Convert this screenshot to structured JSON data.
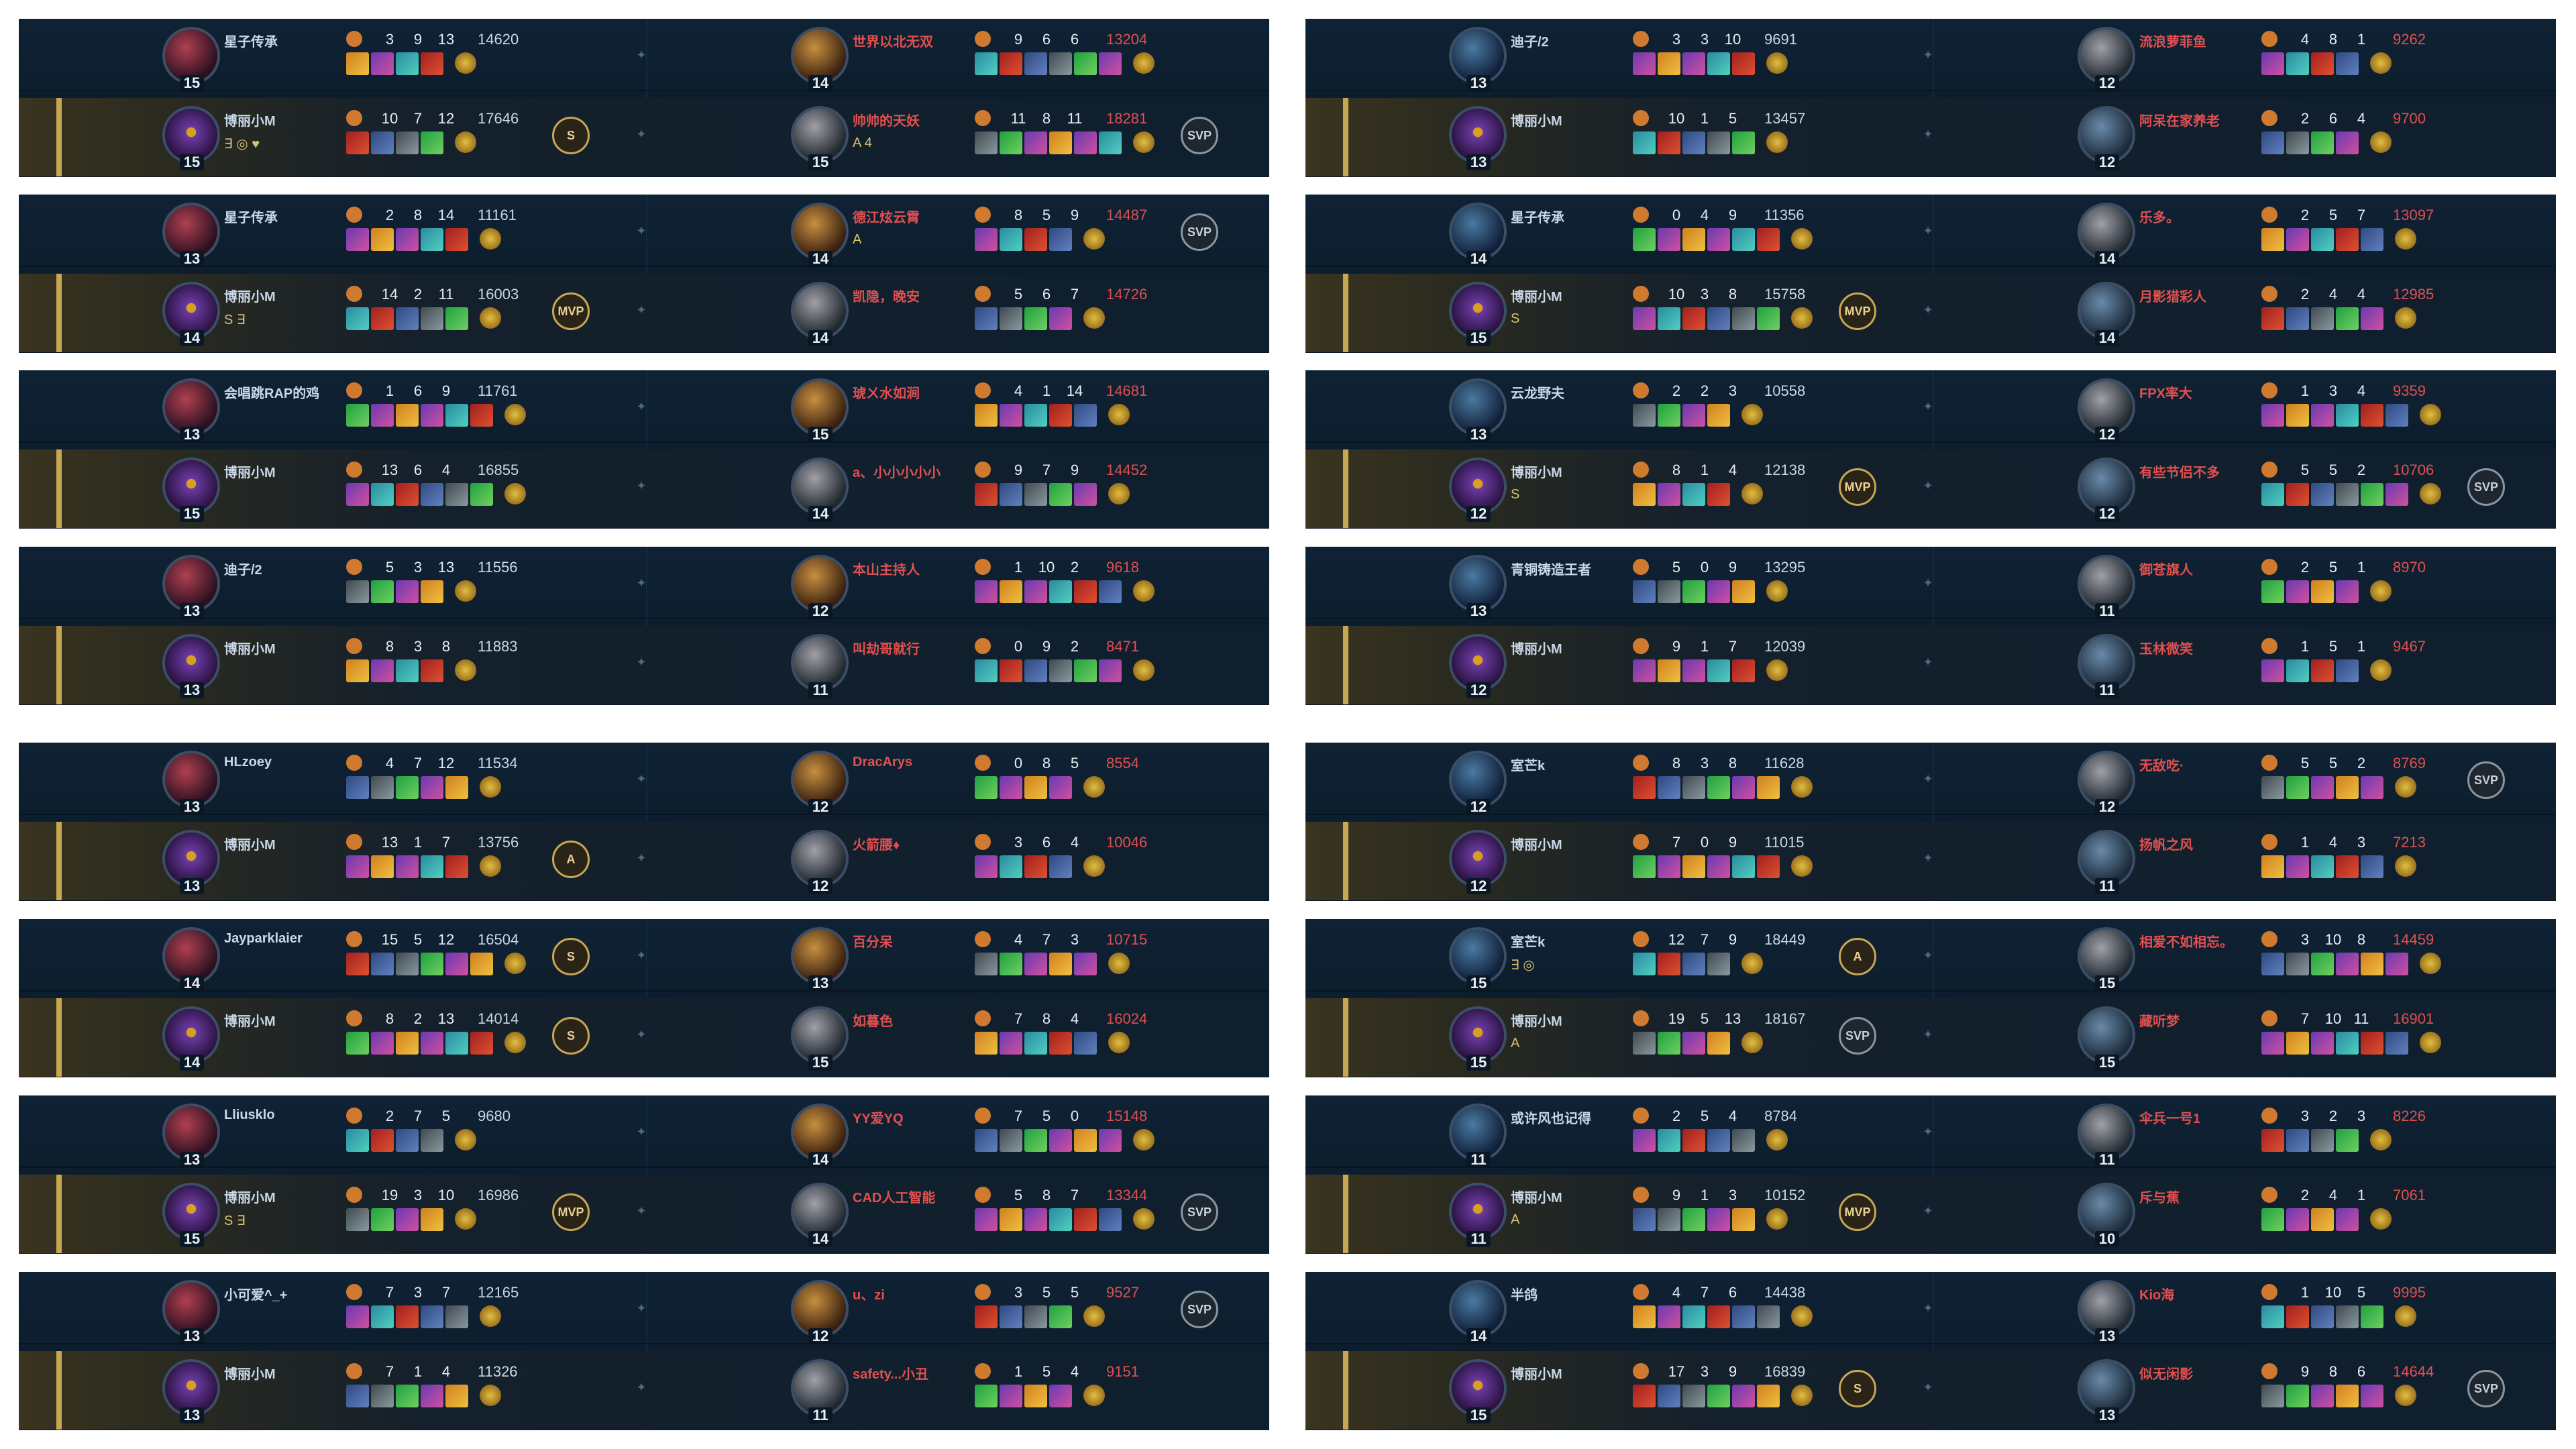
{
  "icons": {
    "kda_rank": "role-icon",
    "item": "item-icon",
    "trinket": "trinket-icon",
    "mvp": "mvp-badge",
    "sword": "sword-icon"
  },
  "colors": {
    "background": "#0b1a2a",
    "gold_ally": "#c8d8e8",
    "gold_enemy": "#e05050",
    "highlight": "#c8a753"
  },
  "columns": [
    {
      "cards": [
        {
          "rows": [
            {
              "L": {
                "name": "星子传承",
                "level": "15",
                "k": "3",
                "d": "9",
                "a": "13",
                "gold": "14620",
                "tags": ""
              },
              "R": {
                "name": "世界以北无双",
                "level": "14",
                "k": "9",
                "d": "6",
                "a": "6",
                "gold": "13204",
                "tags": ""
              },
              "badgeL": "",
              "badgeR": ""
            },
            {
              "L": {
                "name": "博丽小M",
                "level": "15",
                "k": "10",
                "d": "7",
                "a": "12",
                "gold": "17646",
                "tags": "∃ ◎ ♥"
              },
              "R": {
                "name": "帅帅的天妖",
                "level": "15",
                "k": "11",
                "d": "8",
                "a": "11",
                "gold": "18281",
                "tags": "A 4"
              },
              "badgeL": "S",
              "badgeR": "SVP"
            }
          ]
        },
        {
          "rows": [
            {
              "L": {
                "name": "星子传承",
                "level": "13",
                "k": "2",
                "d": "8",
                "a": "14",
                "gold": "11161",
                "tags": ""
              },
              "R": {
                "name": "德江炫云霄",
                "level": "14",
                "k": "8",
                "d": "5",
                "a": "9",
                "gold": "14487",
                "tags": "A"
              },
              "badgeL": "",
              "badgeR": "SVP"
            },
            {
              "L": {
                "name": "博丽小M",
                "level": "14",
                "k": "14",
                "d": "2",
                "a": "11",
                "gold": "16003",
                "tags": "S ∃"
              },
              "R": {
                "name": "凯隐，晚安",
                "level": "14",
                "k": "5",
                "d": "6",
                "a": "7",
                "gold": "14726",
                "tags": ""
              },
              "badgeL": "MVP",
              "badgeR": ""
            }
          ]
        },
        {
          "rows": [
            {
              "L": {
                "name": "会唱跳RAP的鸡",
                "level": "13",
                "k": "1",
                "d": "6",
                "a": "9",
                "gold": "11761",
                "tags": ""
              },
              "R": {
                "name": "琥ㄨ水如涧",
                "level": "15",
                "k": "4",
                "d": "1",
                "a": "14",
                "gold": "14681",
                "tags": ""
              },
              "badgeL": "",
              "badgeR": ""
            },
            {
              "L": {
                "name": "博丽小M",
                "level": "15",
                "k": "13",
                "d": "6",
                "a": "4",
                "gold": "16855",
                "tags": ""
              },
              "R": {
                "name": "a、小小小小小",
                "level": "14",
                "k": "9",
                "d": "7",
                "a": "9",
                "gold": "14452",
                "tags": ""
              },
              "badgeL": "",
              "badgeR": ""
            }
          ]
        },
        {
          "rows": [
            {
              "L": {
                "name": "迪子/2",
                "level": "13",
                "k": "5",
                "d": "3",
                "a": "13",
                "gold": "11556",
                "tags": ""
              },
              "R": {
                "name": "本山主持人",
                "level": "12",
                "k": "1",
                "d": "10",
                "a": "2",
                "gold": "9618",
                "tags": ""
              },
              "badgeL": "",
              "badgeR": ""
            },
            {
              "L": {
                "name": "博丽小M",
                "level": "13",
                "k": "8",
                "d": "3",
                "a": "8",
                "gold": "11883",
                "tags": ""
              },
              "R": {
                "name": "叫劫哥就行",
                "level": "11",
                "k": "0",
                "d": "9",
                "a": "2",
                "gold": "8471",
                "tags": ""
              },
              "badgeL": "",
              "badgeR": ""
            }
          ]
        },
        {
          "rows": [
            {
              "L": {
                "name": "HLzoey",
                "level": "13",
                "k": "4",
                "d": "7",
                "a": "12",
                "gold": "11534",
                "tags": ""
              },
              "R": {
                "name": "DracArys",
                "level": "12",
                "k": "0",
                "d": "8",
                "a": "5",
                "gold": "8554",
                "tags": ""
              },
              "badgeL": "",
              "badgeR": ""
            },
            {
              "L": {
                "name": "博丽小M",
                "level": "13",
                "k": "13",
                "d": "1",
                "a": "7",
                "gold": "13756",
                "tags": ""
              },
              "R": {
                "name": "火箭腰♦",
                "level": "12",
                "k": "3",
                "d": "6",
                "a": "4",
                "gold": "10046",
                "tags": ""
              },
              "badgeL": "A",
              "badgeR": ""
            }
          ]
        },
        {
          "rows": [
            {
              "L": {
                "name": "Jayparklaier",
                "level": "14",
                "k": "15",
                "d": "5",
                "a": "12",
                "gold": "16504",
                "tags": ""
              },
              "R": {
                "name": "百分呆",
                "level": "13",
                "k": "4",
                "d": "7",
                "a": "3",
                "gold": "10715",
                "tags": ""
              },
              "badgeL": "S",
              "badgeR": ""
            },
            {
              "L": {
                "name": "博丽小M",
                "level": "14",
                "k": "8",
                "d": "2",
                "a": "13",
                "gold": "14014",
                "tags": ""
              },
              "R": {
                "name": "如暮色",
                "level": "15",
                "k": "7",
                "d": "8",
                "a": "4",
                "gold": "16024",
                "tags": ""
              },
              "badgeL": "S",
              "badgeR": ""
            }
          ]
        },
        {
          "rows": [
            {
              "L": {
                "name": "Lliusklo",
                "level": "13",
                "k": "2",
                "d": "7",
                "a": "5",
                "gold": "9680",
                "tags": ""
              },
              "R": {
                "name": "YY爱YQ",
                "level": "14",
                "k": "7",
                "d": "5",
                "a": "0",
                "gold": "15148",
                "tags": ""
              },
              "badgeL": "",
              "badgeR": ""
            },
            {
              "L": {
                "name": "博丽小M",
                "level": "15",
                "k": "19",
                "d": "3",
                "a": "10",
                "gold": "16986",
                "tags": "S ∃"
              },
              "R": {
                "name": "CAD人工智能",
                "level": "14",
                "k": "5",
                "d": "8",
                "a": "7",
                "gold": "13344",
                "tags": ""
              },
              "badgeL": "MVP",
              "badgeR": "SVP"
            }
          ]
        },
        {
          "rows": [
            {
              "L": {
                "name": "小可爱^_+",
                "level": "13",
                "k": "7",
                "d": "3",
                "a": "7",
                "gold": "12165",
                "tags": ""
              },
              "R": {
                "name": "u、zi",
                "level": "12",
                "k": "3",
                "d": "5",
                "a": "5",
                "gold": "9527",
                "tags": ""
              },
              "badgeL": "",
              "badgeR": "SVP"
            },
            {
              "L": {
                "name": "博丽小M",
                "level": "13",
                "k": "7",
                "d": "1",
                "a": "4",
                "gold": "11326",
                "tags": ""
              },
              "R": {
                "name": "safety...小丑",
                "level": "11",
                "k": "1",
                "d": "5",
                "a": "4",
                "gold": "9151",
                "tags": ""
              },
              "badgeL": "",
              "badgeR": ""
            }
          ]
        }
      ]
    },
    {
      "cards": [
        {
          "rows": [
            {
              "L": {
                "name": "迪子/2",
                "level": "13",
                "k": "3",
                "d": "3",
                "a": "10",
                "gold": "9691",
                "tags": ""
              },
              "R": {
                "name": "流浪萝菲鱼",
                "level": "12",
                "k": "4",
                "d": "8",
                "a": "1",
                "gold": "9262",
                "tags": ""
              },
              "badgeL": "",
              "badgeR": ""
            },
            {
              "L": {
                "name": "博丽小M",
                "level": "13",
                "k": "10",
                "d": "1",
                "a": "5",
                "gold": "13457",
                "tags": ""
              },
              "R": {
                "name": "阿呆在家养老",
                "level": "12",
                "k": "2",
                "d": "6",
                "a": "4",
                "gold": "9700",
                "tags": ""
              },
              "badgeL": "",
              "badgeR": ""
            }
          ]
        },
        {
          "rows": [
            {
              "L": {
                "name": "星子传承",
                "level": "14",
                "k": "0",
                "d": "4",
                "a": "9",
                "gold": "11356",
                "tags": ""
              },
              "R": {
                "name": "乐多。",
                "level": "14",
                "k": "2",
                "d": "5",
                "a": "7",
                "gold": "13097",
                "tags": ""
              },
              "badgeL": "",
              "badgeR": ""
            },
            {
              "L": {
                "name": "博丽小M",
                "level": "15",
                "k": "10",
                "d": "3",
                "a": "8",
                "gold": "15758",
                "tags": "S"
              },
              "R": {
                "name": "月影猎彩人",
                "level": "14",
                "k": "2",
                "d": "4",
                "a": "4",
                "gold": "12985",
                "tags": ""
              },
              "badgeL": "MVP",
              "badgeR": ""
            }
          ]
        },
        {
          "rows": [
            {
              "L": {
                "name": "云龙野夫",
                "level": "13",
                "k": "2",
                "d": "2",
                "a": "3",
                "gold": "10558",
                "tags": ""
              },
              "R": {
                "name": "FPX率大",
                "level": "12",
                "k": "1",
                "d": "3",
                "a": "4",
                "gold": "9359",
                "tags": ""
              },
              "badgeL": "",
              "badgeR": ""
            },
            {
              "L": {
                "name": "博丽小M",
                "level": "12",
                "k": "8",
                "d": "1",
                "a": "4",
                "gold": "12138",
                "tags": "S"
              },
              "R": {
                "name": "有些节侣不多",
                "level": "12",
                "k": "5",
                "d": "5",
                "a": "2",
                "gold": "10706",
                "tags": ""
              },
              "badgeL": "MVP",
              "badgeR": "SVP"
            }
          ]
        },
        {
          "rows": [
            {
              "L": {
                "name": "青铜铸造王者",
                "level": "13",
                "k": "5",
                "d": "0",
                "a": "9",
                "gold": "13295",
                "tags": ""
              },
              "R": {
                "name": "御苍旗人",
                "level": "11",
                "k": "2",
                "d": "5",
                "a": "1",
                "gold": "8970",
                "tags": ""
              },
              "badgeL": "",
              "badgeR": ""
            },
            {
              "L": {
                "name": "博丽小M",
                "level": "12",
                "k": "9",
                "d": "1",
                "a": "7",
                "gold": "12039",
                "tags": ""
              },
              "R": {
                "name": "玉林微笑",
                "level": "11",
                "k": "1",
                "d": "5",
                "a": "1",
                "gold": "9467",
                "tags": ""
              },
              "badgeL": "",
              "badgeR": ""
            }
          ]
        },
        {
          "rows": [
            {
              "L": {
                "name": "室芒k",
                "level": "12",
                "k": "8",
                "d": "3",
                "a": "8",
                "gold": "11628",
                "tags": ""
              },
              "R": {
                "name": "无敌吃·",
                "level": "12",
                "k": "5",
                "d": "5",
                "a": "2",
                "gold": "8769",
                "tags": ""
              },
              "badgeL": "",
              "badgeR": "SVP"
            },
            {
              "L": {
                "name": "博丽小M",
                "level": "12",
                "k": "7",
                "d": "0",
                "a": "9",
                "gold": "11015",
                "tags": ""
              },
              "R": {
                "name": "扬帆之风",
                "level": "11",
                "k": "1",
                "d": "4",
                "a": "3",
                "gold": "7213",
                "tags": ""
              },
              "badgeL": "",
              "badgeR": ""
            }
          ]
        },
        {
          "rows": [
            {
              "L": {
                "name": "室芒k",
                "level": "15",
                "k": "12",
                "d": "7",
                "a": "9",
                "gold": "18449",
                "tags": "∃ ◎"
              },
              "R": {
                "name": "相爱不如相忘。",
                "level": "15",
                "k": "3",
                "d": "10",
                "a": "8",
                "gold": "14459",
                "tags": ""
              },
              "badgeL": "A",
              "badgeR": ""
            },
            {
              "L": {
                "name": "博丽小M",
                "level": "15",
                "k": "19",
                "d": "5",
                "a": "13",
                "gold": "18167",
                "tags": "A"
              },
              "R": {
                "name": "藏听梦",
                "level": "15",
                "k": "7",
                "d": "10",
                "a": "11",
                "gold": "16901",
                "tags": ""
              },
              "badgeL": "SVP",
              "badgeR": ""
            }
          ]
        },
        {
          "rows": [
            {
              "L": {
                "name": "或许风也记得",
                "level": "11",
                "k": "2",
                "d": "5",
                "a": "4",
                "gold": "8784",
                "tags": ""
              },
              "R": {
                "name": "伞兵一号1",
                "level": "11",
                "k": "3",
                "d": "2",
                "a": "3",
                "gold": "8226",
                "tags": ""
              },
              "badgeL": "",
              "badgeR": ""
            },
            {
              "L": {
                "name": "博丽小M",
                "level": "11",
                "k": "9",
                "d": "1",
                "a": "3",
                "gold": "10152",
                "tags": "A"
              },
              "R": {
                "name": "斥与蕉",
                "level": "10",
                "k": "2",
                "d": "4",
                "a": "1",
                "gold": "7061",
                "tags": ""
              },
              "badgeL": "MVP",
              "badgeR": ""
            }
          ]
        },
        {
          "rows": [
            {
              "L": {
                "name": "半鸽",
                "level": "14",
                "k": "4",
                "d": "7",
                "a": "6",
                "gold": "14438",
                "tags": ""
              },
              "R": {
                "name": "Kio海",
                "level": "13",
                "k": "1",
                "d": "10",
                "a": "5",
                "gold": "9995",
                "tags": ""
              },
              "badgeL": "",
              "badgeR": ""
            },
            {
              "L": {
                "name": "博丽小M",
                "level": "15",
                "k": "17",
                "d": "3",
                "a": "9",
                "gold": "16839",
                "tags": ""
              },
              "R": {
                "name": "似无闲影",
                "level": "13",
                "k": "9",
                "d": "8",
                "a": "6",
                "gold": "14644",
                "tags": ""
              },
              "badgeL": "S",
              "badgeR": "SVP"
            }
          ]
        }
      ]
    }
  ]
}
